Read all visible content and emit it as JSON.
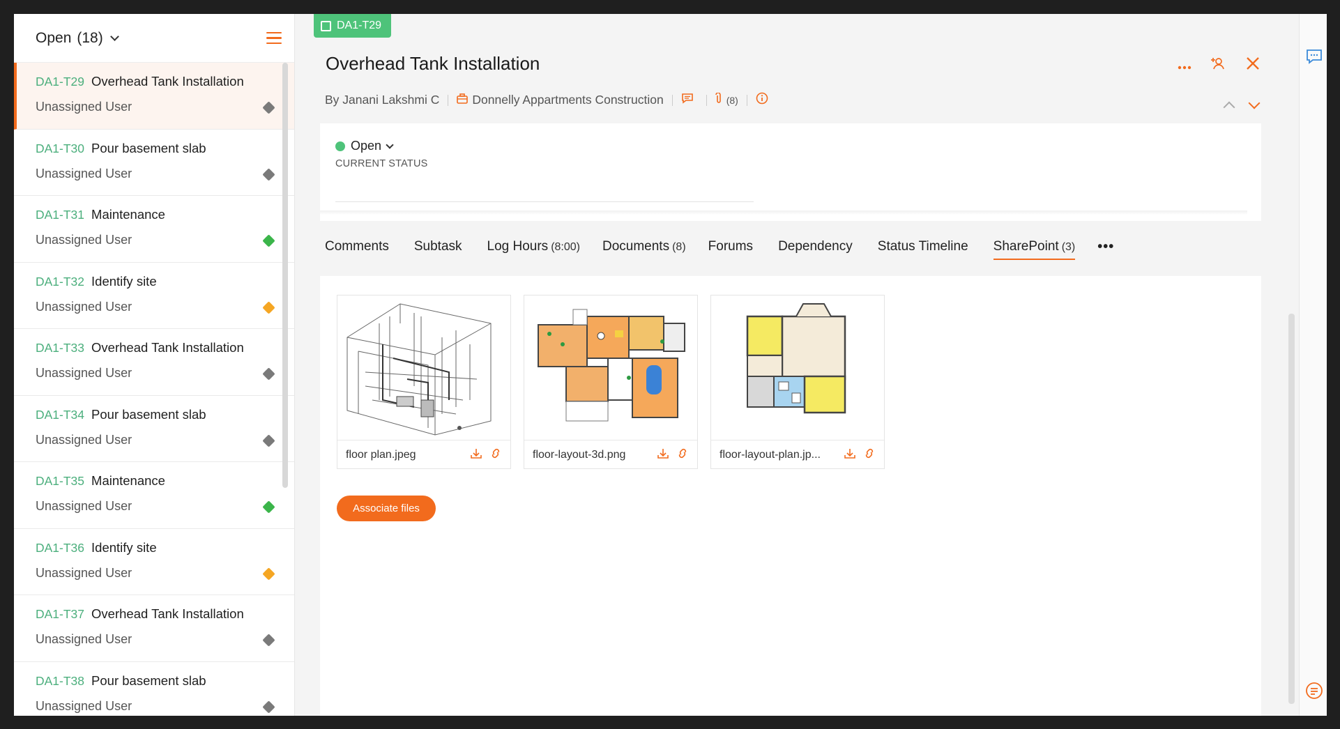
{
  "list": {
    "filter_label": "Open",
    "filter_count": "(18)",
    "tasks": [
      {
        "id": "DA1-T29",
        "name": "Overhead Tank Installation",
        "owner": "Unassigned User",
        "priority_color": "#7a7a7a"
      },
      {
        "id": "DA1-T30",
        "name": "Pour basement slab",
        "owner": "Unassigned User",
        "priority_color": "#7a7a7a"
      },
      {
        "id": "DA1-T31",
        "name": "Maintenance",
        "owner": "Unassigned User",
        "priority_color": "#3bb54a"
      },
      {
        "id": "DA1-T32",
        "name": "Identify site",
        "owner": "Unassigned User",
        "priority_color": "#f5a623"
      },
      {
        "id": "DA1-T33",
        "name": "Overhead Tank Installation",
        "owner": "Unassigned User",
        "priority_color": "#7a7a7a"
      },
      {
        "id": "DA1-T34",
        "name": "Pour basement slab",
        "owner": "Unassigned User",
        "priority_color": "#7a7a7a"
      },
      {
        "id": "DA1-T35",
        "name": "Maintenance",
        "owner": "Unassigned User",
        "priority_color": "#3bb54a"
      },
      {
        "id": "DA1-T36",
        "name": "Identify site",
        "owner": "Unassigned User",
        "priority_color": "#f5a623"
      },
      {
        "id": "DA1-T37",
        "name": "Overhead Tank Installation",
        "owner": "Unassigned User",
        "priority_color": "#7a7a7a"
      },
      {
        "id": "DA1-T38",
        "name": "Pour basement slab",
        "owner": "Unassigned User",
        "priority_color": "#7a7a7a"
      }
    ]
  },
  "detail": {
    "badge": "DA1-T29",
    "title": "Overhead Tank Installation",
    "author": "By Janani Lakshmi C",
    "project": "Donnelly Appartments Construction",
    "attachments": "(8)",
    "status": "Open",
    "status_label": "CURRENT STATUS",
    "tabs": [
      {
        "label": "Comments",
        "count": ""
      },
      {
        "label": "Subtask",
        "count": ""
      },
      {
        "label": "Log Hours",
        "count": "(8:00)"
      },
      {
        "label": "Documents",
        "count": "(8)"
      },
      {
        "label": "Forums",
        "count": ""
      },
      {
        "label": "Dependency",
        "count": ""
      },
      {
        "label": "Status Timeline",
        "count": ""
      },
      {
        "label": "SharePoint",
        "count": "(3)"
      }
    ],
    "more_tabs": "•••",
    "files": [
      {
        "name": "floor plan.jpeg"
      },
      {
        "name": "floor-layout-3d.png"
      },
      {
        "name": "floor-layout-plan.jp..."
      }
    ],
    "associate_label": "Associate files"
  },
  "colors": {
    "accent": "#f26b1d",
    "green": "#4ec37a"
  }
}
